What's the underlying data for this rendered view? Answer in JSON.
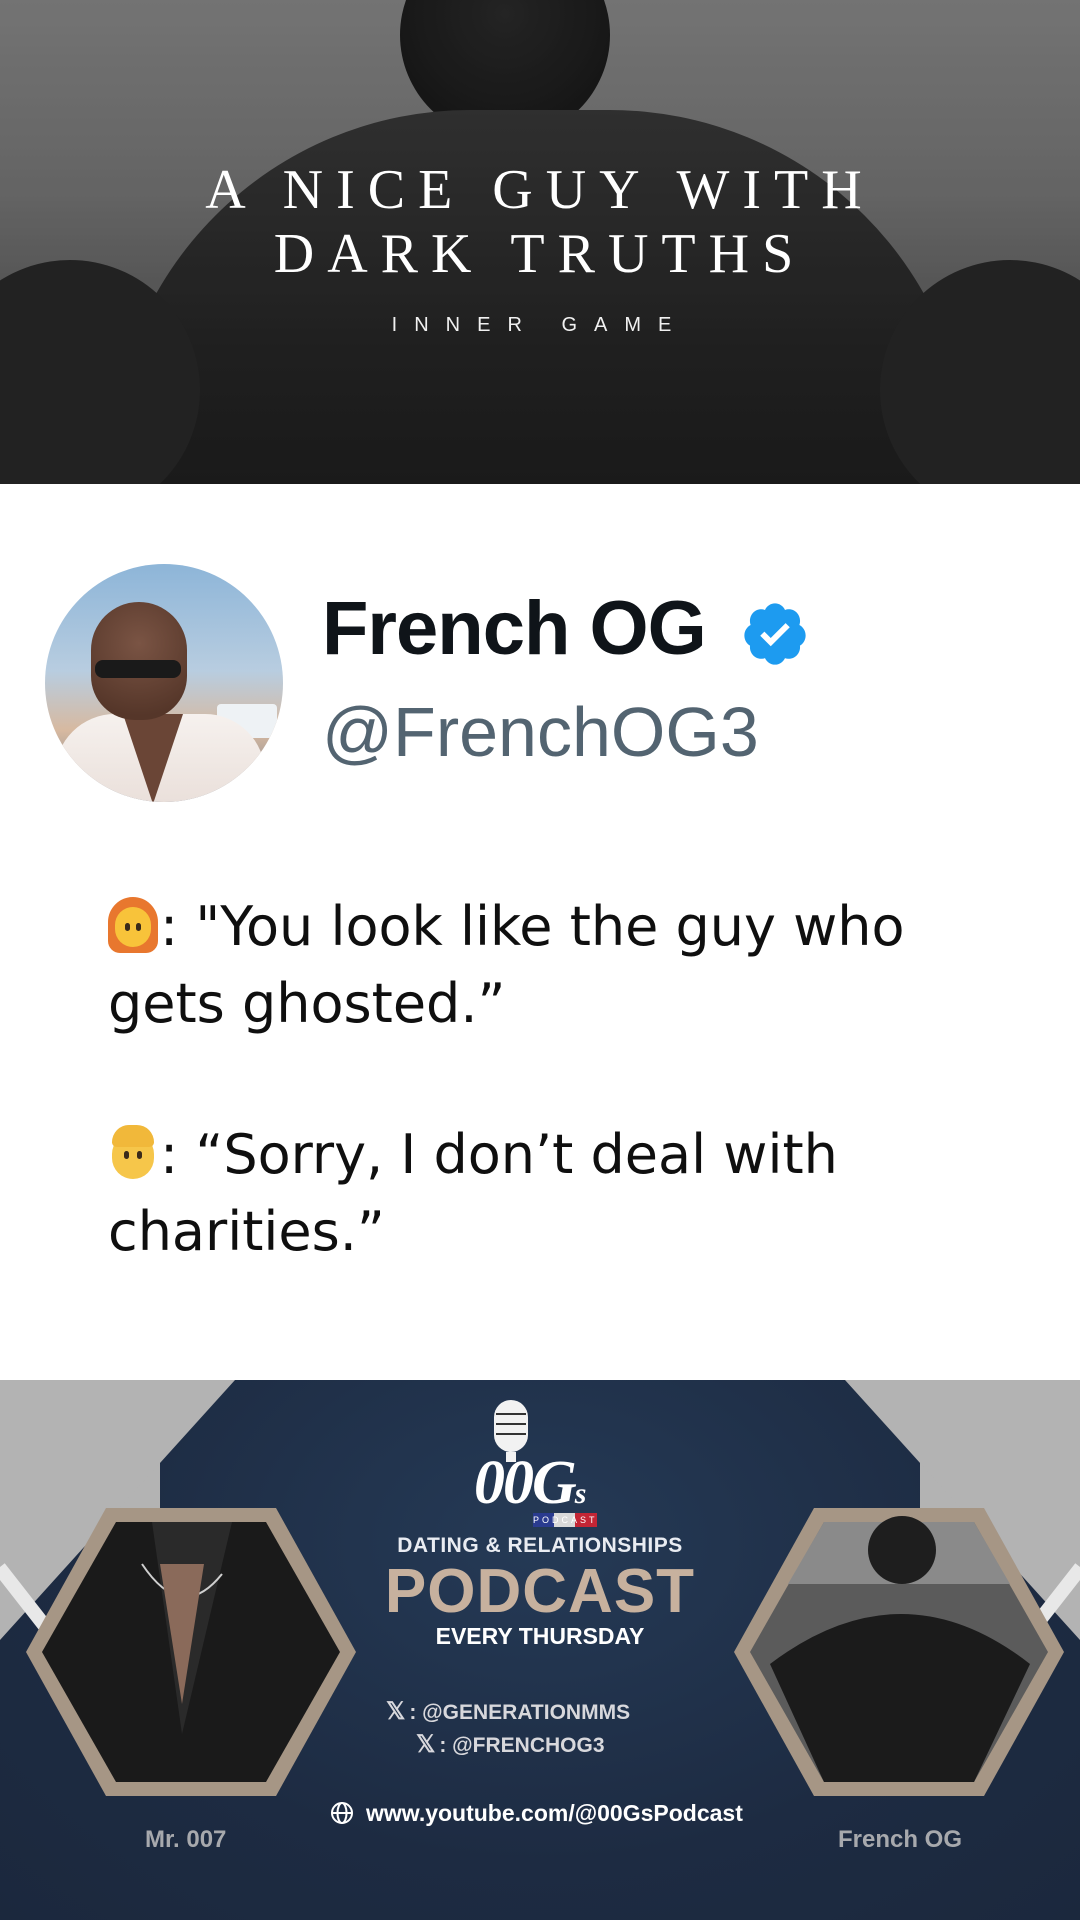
{
  "banner": {
    "title": "A NICE GUY WITH DARK TRUTHS",
    "subtitle": "INNER GAME"
  },
  "profile": {
    "name": "French OG",
    "handle": "@FrenchOG3",
    "verified_color": "#1d9bf0",
    "avatar_icon": "profile-photo"
  },
  "tweet": {
    "line1_emoji": "woman-red-hair-emoji",
    "line1_a": ": \"You look like the guy who",
    "line1_b": "gets ghosted.”",
    "line2_emoji": "man-blond-emoji",
    "line2_a": ": “Sorry, I don’t deal with",
    "line2_b": "charities.”"
  },
  "footer": {
    "brand": "00G",
    "brand_suffix": "s",
    "badge": "PODCAST",
    "tagline": "DATING & RELATIONSHIPS",
    "headline": "PODCAST",
    "schedule": "EVERY THURSDAY",
    "x_handle_1": ": @GENERATIONMMS",
    "x_handle_2": ": @FRENCHOG3",
    "x_icon": "𝕏",
    "youtube": "www.youtube.com/@00GsPodcast",
    "host_left": "Mr. 007",
    "host_right": "French OG",
    "accent": "#c7b19e",
    "navy": "#1d2b42"
  }
}
